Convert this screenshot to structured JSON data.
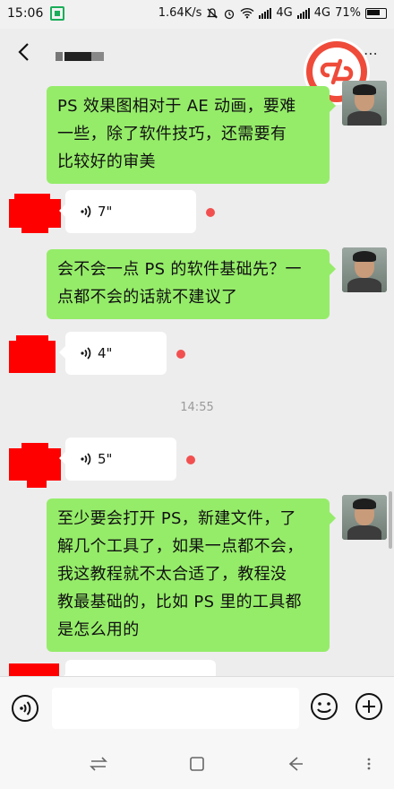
{
  "status_bar": {
    "time": "15:06",
    "network_speed": "1.64K/s",
    "network_type_1": "4G",
    "network_type_2": "4G",
    "battery": "71%"
  },
  "chat": {
    "timestamp": "14:55",
    "messages": [
      {
        "from": "me",
        "type": "text",
        "lines": [
          "PS 效果图相对于 AE 动画，要难",
          "一些，除了软件技巧，还需要有",
          "比较好的审美"
        ]
      },
      {
        "from": "other",
        "type": "voice",
        "duration": "7\"",
        "unread": true
      },
      {
        "from": "me",
        "type": "text",
        "lines": [
          "会不会一点 PS 的软件基础先？一",
          "点都不会的话就不建议了"
        ]
      },
      {
        "from": "other",
        "type": "voice",
        "duration": "4\"",
        "unread": true
      },
      {
        "from": "other",
        "type": "voice",
        "duration": "5\"",
        "unread": true
      },
      {
        "from": "me",
        "type": "text",
        "lines": [
          "至少要会打开 PS，新建文件，了",
          "解几个工具了，如果一点都不会，",
          "我这教程就不太合适了，教程没",
          "教最基础的，比如 PS 里的工具都",
          "是怎么用的"
        ]
      }
    ]
  },
  "input_bar": {
    "placeholder": ""
  },
  "colors": {
    "my_bubble": "#95ec69",
    "other_bubble": "#ffffff",
    "unread_dot": "#f25050",
    "redaction": "#ff0000"
  }
}
